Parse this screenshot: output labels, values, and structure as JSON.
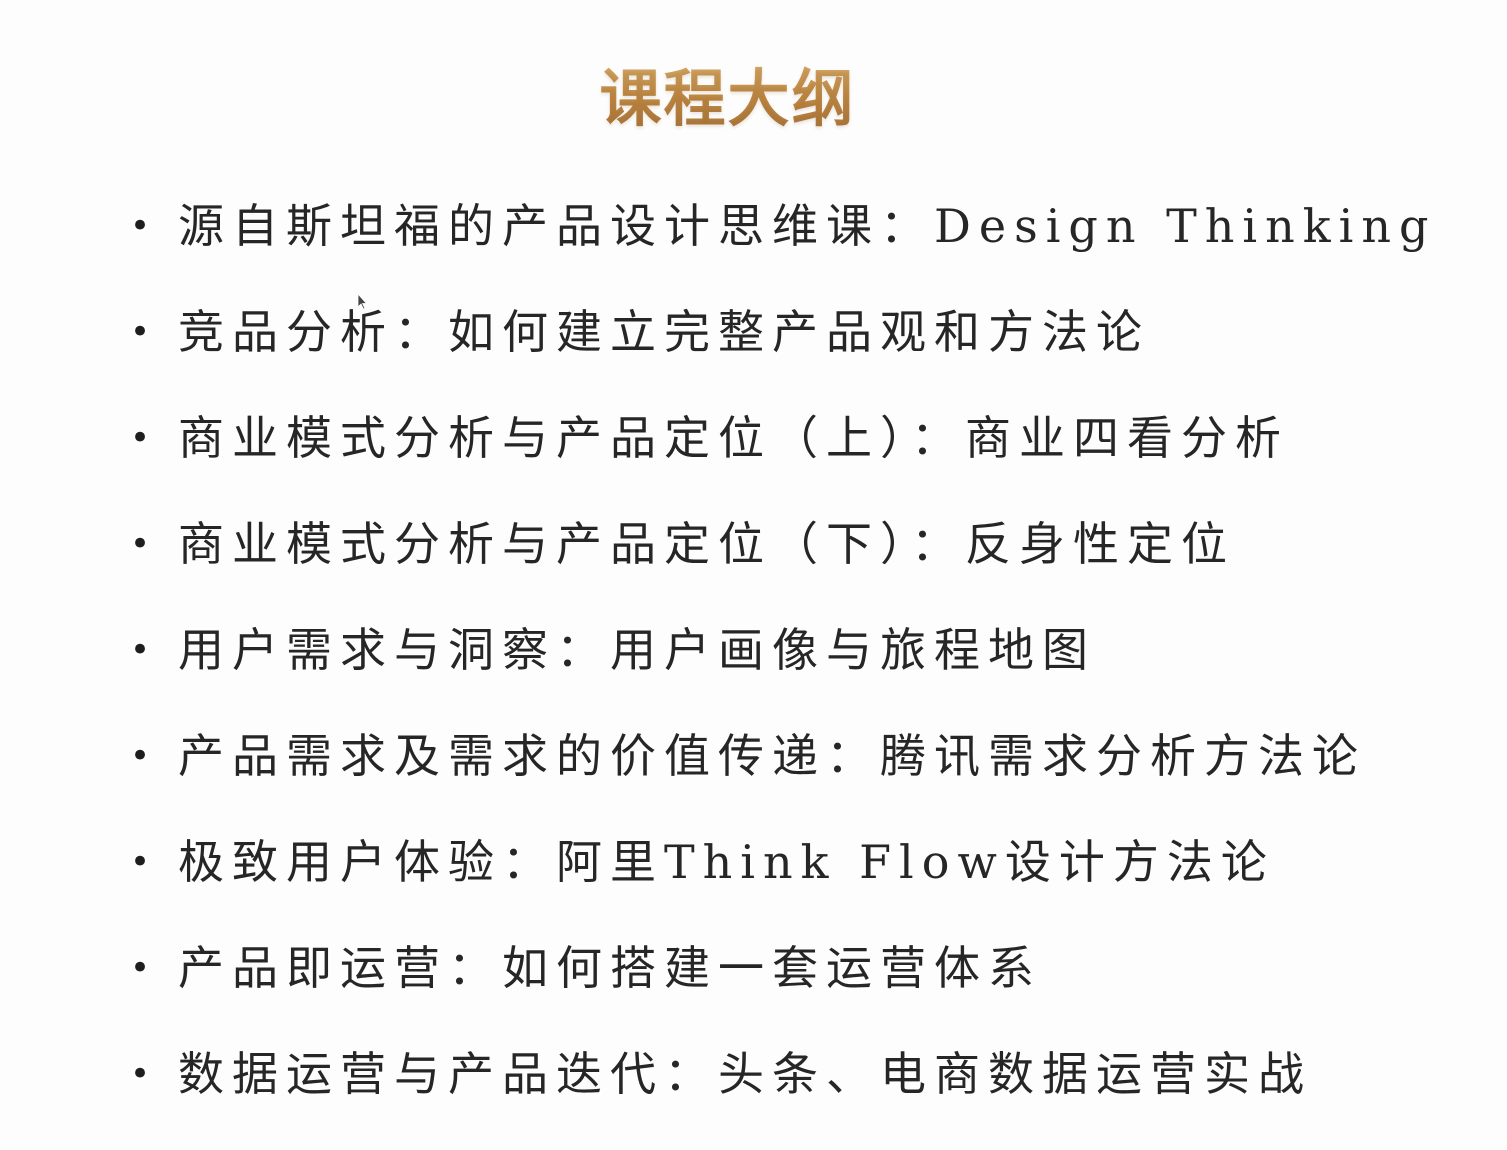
{
  "slide": {
    "title": "课程大纲",
    "title_color": "#c28a45",
    "bullet_symbol": "•",
    "items": [
      "源自斯坦福的产品设计思维课：Design Thinking",
      "竞品分析：如何建立完整产品观和方法论",
      "商业模式分析与产品定位（上）：商业四看分析",
      "商业模式分析与产品定位（下）：反身性定位",
      "用户需求与洞察：用户画像与旅程地图",
      "产品需求及需求的价值传递：腾讯需求分析方法论",
      "极致用户体验：阿里Think Flow设计方法论",
      "产品即运营：如何搭建一套运营体系",
      "数据运营与产品迭代：头条、电商数据运营实战"
    ]
  }
}
